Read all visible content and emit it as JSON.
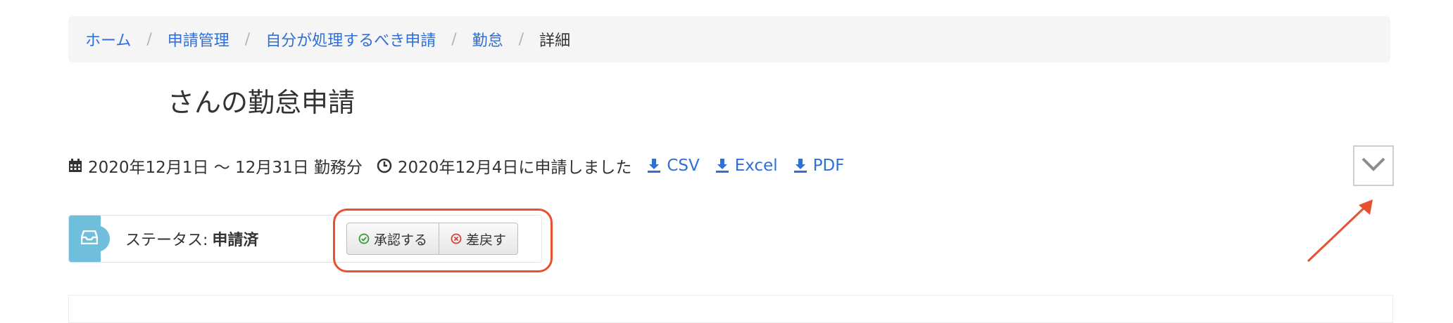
{
  "breadcrumb": {
    "items": [
      "ホーム",
      "申請管理",
      "自分が処理するべき申請",
      "勤怠"
    ],
    "active": "詳細",
    "separator": "/"
  },
  "title": "さんの勤怠申請",
  "meta": {
    "period": "2020年12月1日 〜 12月31日 勤務分",
    "applied": "2020年12月4日に申請しました",
    "downloads": [
      "CSV",
      "Excel",
      "PDF"
    ]
  },
  "status": {
    "label": "ステータス:",
    "value": "申請済"
  },
  "actions": {
    "approve": "承認する",
    "reject": "差戻す"
  },
  "colors": {
    "link": "#2f6fd6",
    "status_icon_bg": "#6fbedb",
    "annotation": "#e6512f",
    "approve_icon": "#3a9a3a",
    "reject_icon": "#d9413a"
  },
  "icons": {
    "period": "calendar-icon",
    "applied": "clock-icon",
    "download": "download-icon",
    "status": "inbox-icon",
    "approve": "check-circle-icon",
    "reject": "x-circle-icon",
    "collapse": "chevron-down-icon"
  }
}
